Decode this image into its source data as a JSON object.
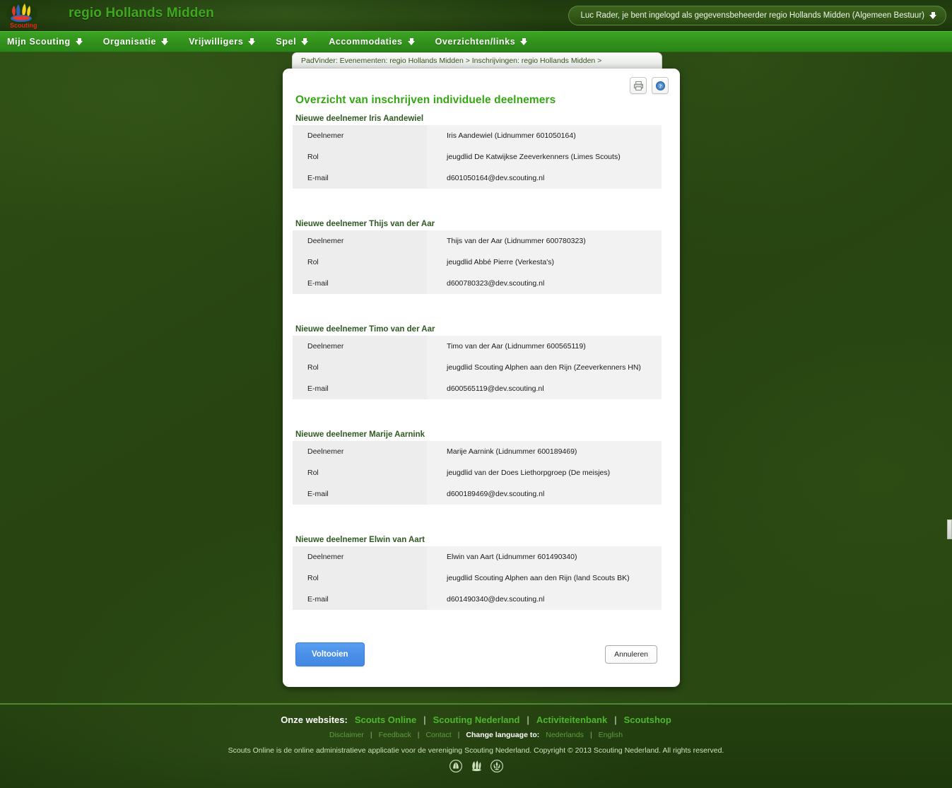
{
  "header": {
    "logo_alt": "Scouting Nederland",
    "site_title": "regio Hollands Midden",
    "user_status": "Luc Rader, je bent ingelogd als gegevensbeheerder regio Hollands Midden (Algemeen Bestuur)"
  },
  "nav": {
    "items": [
      {
        "label": "Mijn Scouting"
      },
      {
        "label": "Organisatie"
      },
      {
        "label": "Vrijwilligers"
      },
      {
        "label": "Spel"
      },
      {
        "label": "Accommodaties"
      },
      {
        "label": "Overzichten/links"
      }
    ]
  },
  "breadcrumb": {
    "text": "PadVinder:  Evenementen: regio Hollands Midden > Inschrijvingen: regio Hollands Midden >"
  },
  "tools": {
    "print_icon": "printer-icon",
    "help_icon": "help-icon"
  },
  "main": {
    "page_title": "Overzicht van inschrijven individuele deelnemers",
    "row_labels": {
      "deelnemer": "Deelnemer",
      "rol": "Rol",
      "email": "E-mail"
    },
    "participants": [
      {
        "heading": "Nieuwe deelnemer Iris Aandewiel",
        "deelnemer": "Iris Aandewiel (Lidnummer 601050164)",
        "rol": "jeugdlid De Katwijkse Zeeverkenners (Limes Scouts)",
        "email": "d601050164@dev.scouting.nl"
      },
      {
        "heading": "Nieuwe deelnemer Thijs van der Aar",
        "deelnemer": "Thijs van der Aar (Lidnummer 600780323)",
        "rol": "jeugdlid Abbé Pierre (Verkesta's)",
        "email": "d600780323@dev.scouting.nl"
      },
      {
        "heading": "Nieuwe deelnemer Timo van der Aar",
        "deelnemer": "Timo van der Aar (Lidnummer 600565119)",
        "rol": "jeugdlid Scouting Alphen aan den Rijn (Zeeverkenners HN)",
        "email": "d600565119@dev.scouting.nl"
      },
      {
        "heading": "Nieuwe deelnemer Marije Aarnink",
        "deelnemer": "Marije Aarnink (Lidnummer 600189469)",
        "rol": "jeugdlid van der Does Liethorpgroep (De meisjes)",
        "email": "d600189469@dev.scouting.nl"
      },
      {
        "heading": "Nieuwe deelnemer Elwin van Aart",
        "deelnemer": "Elwin van Aart (Lidnummer 601490340)",
        "rol": "jeugdlid Scouting Alphen aan den Rijn (land Scouts BK)",
        "email": "d601490340@dev.scouting.nl"
      }
    ],
    "submit_label": "Voltooien",
    "cancel_label": "Annuleren"
  },
  "footer": {
    "sites_label": "Onze websites:",
    "sites": [
      {
        "label": "Scouts Online"
      },
      {
        "label": "Scouting Nederland"
      },
      {
        "label": "Activiteitenbank"
      },
      {
        "label": "Scoutshop"
      }
    ],
    "links": [
      {
        "label": "Disclaimer"
      },
      {
        "label": "Feedback"
      },
      {
        "label": "Contact"
      }
    ],
    "language_label": "Change language to:",
    "languages": [
      {
        "label": "Nederlands"
      },
      {
        "label": "English"
      }
    ],
    "separator": "|",
    "copyright": "Scouts Online is de online administratieve applicatie voor de vereniging Scouting Nederland. Copyright © 2013 Scouting Nederland. All rights reserved."
  },
  "colors": {
    "page_bg": "#2a4a12",
    "nav_green": "#32931c",
    "title_green": "#34a713",
    "heading_green": "#2f5a22",
    "primary_button": "#4a90e8",
    "table_bg": "#f1f1f1"
  }
}
